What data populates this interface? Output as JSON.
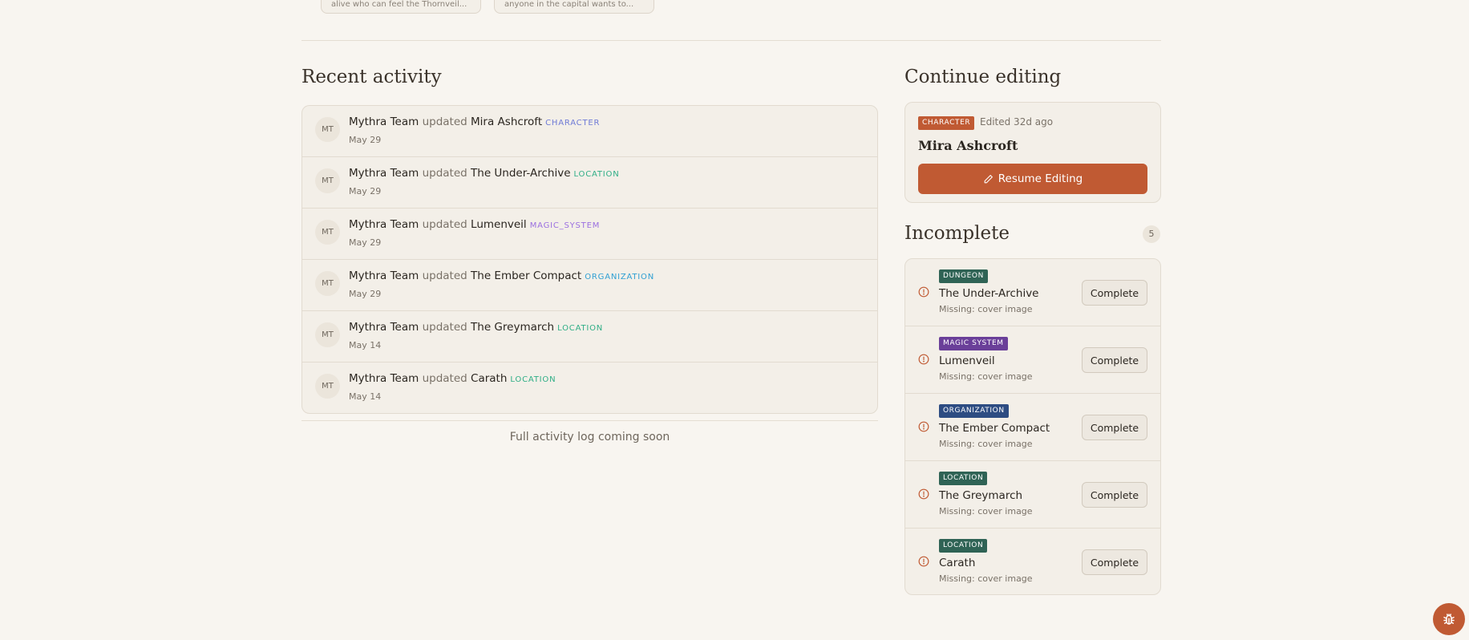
{
  "top_cards": [
    {
      "text": "alive who can feel the Thornveil..."
    },
    {
      "text": "anyone in the capital wants to..."
    }
  ],
  "recent_activity": {
    "title": "Recent activity",
    "items": [
      {
        "initials": "MT",
        "user": "Mythra Team",
        "verb": "updated",
        "entity": "Mira Ashcroft",
        "type": "CHARACTER",
        "type_color": "#6e7ad6",
        "date": "May 29"
      },
      {
        "initials": "MT",
        "user": "Mythra Team",
        "verb": "updated",
        "entity": "The Under-Archive",
        "type": "LOCATION",
        "type_color": "#2fae86",
        "date": "May 29"
      },
      {
        "initials": "MT",
        "user": "Mythra Team",
        "verb": "updated",
        "entity": "Lumenveil",
        "type": "MAGIC_SYSTEM",
        "type_color": "#9b6fe0",
        "date": "May 29"
      },
      {
        "initials": "MT",
        "user": "Mythra Team",
        "verb": "updated",
        "entity": "The Ember Compact",
        "type": "ORGANIZATION",
        "type_color": "#2f9fd3",
        "date": "May 29"
      },
      {
        "initials": "MT",
        "user": "Mythra Team",
        "verb": "updated",
        "entity": "The Greymarch",
        "type": "LOCATION",
        "type_color": "#2fae86",
        "date": "May 14"
      },
      {
        "initials": "MT",
        "user": "Mythra Team",
        "verb": "updated",
        "entity": "Carath",
        "type": "LOCATION",
        "type_color": "#2fae86",
        "date": "May 14"
      }
    ],
    "footer": "Full activity log coming soon"
  },
  "continue_editing": {
    "title": "Continue editing",
    "badge": "CHARACTER",
    "badge_color": "#c05a33",
    "edited": "Edited 32d ago",
    "name": "Mira Ashcroft",
    "button": "Resume Editing"
  },
  "incomplete": {
    "title": "Incomplete",
    "count": "5",
    "button_label": "Complete",
    "items": [
      {
        "badge": "DUNGEON",
        "badge_color": "#2f6355",
        "name": "The Under-Archive",
        "missing": "Missing: cover image"
      },
      {
        "badge": "MAGIC SYSTEM",
        "badge_color": "#6a3f99",
        "name": "Lumenveil",
        "missing": "Missing: cover image"
      },
      {
        "badge": "ORGANIZATION",
        "badge_color": "#2d4c82",
        "name": "The Ember Compact",
        "missing": "Missing: cover image"
      },
      {
        "badge": "LOCATION",
        "badge_color": "#2f6355",
        "name": "The Greymarch",
        "missing": "Missing: cover image"
      },
      {
        "badge": "LOCATION",
        "badge_color": "#2f6355",
        "name": "Carath",
        "missing": "Missing: cover image"
      }
    ]
  },
  "colors": {
    "accent": "#c05a33",
    "background": "#f8f5f0",
    "warning": "#c05a33"
  },
  "icons": {
    "resume": "pencil-icon",
    "warning": "alert-circle-icon",
    "floating": "bug-icon"
  }
}
